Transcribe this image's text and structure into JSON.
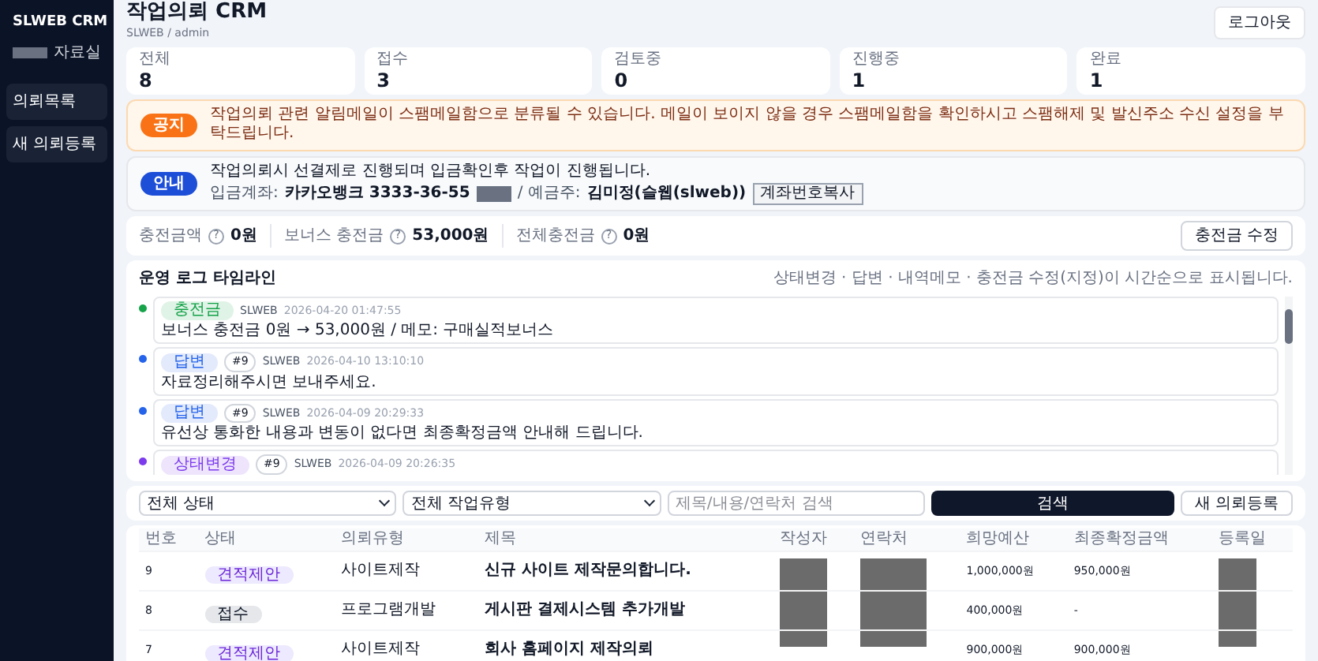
{
  "sidebar": {
    "brand": "SLWEB CRM",
    "subtitle": "자료실",
    "items": [
      {
        "label": "의뢰목록"
      },
      {
        "label": "새 의뢰등록"
      }
    ]
  },
  "header": {
    "title": "작업의뢰 CRM",
    "breadcrumb": "SLWEB / admin",
    "logout": "로그아웃"
  },
  "stats": [
    {
      "label": "전체",
      "value": "8"
    },
    {
      "label": "접수",
      "value": "3"
    },
    {
      "label": "검토중",
      "value": "0"
    },
    {
      "label": "진행중",
      "value": "1"
    },
    {
      "label": "완료",
      "value": "1"
    }
  ],
  "notice": {
    "badge": "공지",
    "text": "작업의뢰 관련 알림메일이 스팸메일함으로 분류될 수 있습니다. 메일이 보이지 않을 경우 스팸메일함을 확인하시고 스팸해제 및 발신주소 수신 설정을 부탁드립니다."
  },
  "info": {
    "badge": "안내",
    "text": "작업의뢰시 선결제로 진행되며 입금확인후 작업이 진행됩니다.",
    "account_label": "입금계좌:",
    "account": "카카오뱅크 3333-36-55",
    "holder_label": "/ 예금주:",
    "holder": "김미정(슬웹(slweb))",
    "copy": "계좌번호복사"
  },
  "balance": {
    "items": [
      {
        "label": "충전금액",
        "help": "?",
        "value": "0원"
      },
      {
        "label": "보너스 충전금",
        "help": "?",
        "value": "53,000원"
      },
      {
        "label": "전체충전금",
        "help": "?",
        "value": "0원"
      }
    ],
    "button": "충전금 수정"
  },
  "timeline": {
    "title": "운영 로그 타임라인",
    "note": "상태변경 · 답변 · 내역메모 · 충전금 수정(지정)이 시간순으로 표시됩니다.",
    "entries": [
      {
        "tag": "충전금",
        "color": "#16a34a",
        "author": "SLWEB",
        "time": "2026-04-20 01:47:55",
        "text": "보너스 충전금 0원 → 53,000원 / 메모: 구매실적보너스"
      },
      {
        "tag": "답변",
        "color": "#2563eb",
        "ref": "#9",
        "author": "SLWEB",
        "time": "2026-04-10 13:10:10",
        "text": "자료정리해주시면 보내주세요."
      },
      {
        "tag": "답변",
        "color": "#2563eb",
        "ref": "#9",
        "author": "SLWEB",
        "time": "2026-04-09 20:29:33",
        "text": "유선상 통화한 내용과 변동이 없다면 최종확정금액 안내해 드립니다."
      },
      {
        "tag": "상태변경",
        "color": "#7c3aed",
        "ref": "#9",
        "author": "SLWEB",
        "time": "2026-04-09 20:26:35"
      }
    ]
  },
  "filters": {
    "status": "전체 상태",
    "type": "전체 작업유형",
    "search_placeholder": "제목/내용/연락처 검색",
    "search": "검색",
    "new": "새 의뢰등록"
  },
  "table": {
    "columns": [
      "번호",
      "상태",
      "의뢰유형",
      "제목",
      "작성자",
      "연락처",
      "희망예산",
      "최종확정금액",
      "등록일"
    ],
    "rows": [
      {
        "no": "9",
        "status": "견적제안",
        "kind": "quote",
        "type": "사이트제작",
        "title": "신규 사이트 제작문의합니다.",
        "budget": "1,000,000원",
        "final": "950,000원"
      },
      {
        "no": "8",
        "status": "접수",
        "kind": "received",
        "type": "프로그램개발",
        "title": "게시판 결제시스템 추가개발",
        "budget": "400,000원",
        "final": "-"
      },
      {
        "no": "7",
        "status": "견적제안",
        "kind": "quote",
        "type": "사이트제작",
        "title": "회사 홈페이지 제작의뢰",
        "budget": "900,000원",
        "final": "900,000원"
      }
    ]
  }
}
